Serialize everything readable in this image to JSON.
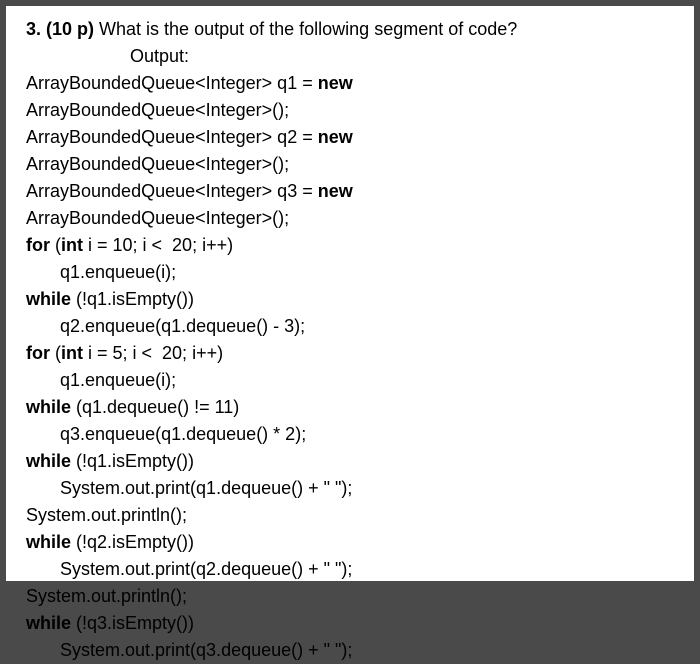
{
  "question": {
    "number_prefix": "3. (10 p) ",
    "prompt": "What is the output of the following segment of code?",
    "output_label": "Output:"
  },
  "code": {
    "l1a": "ArrayBoundedQueue<Integer> q1 = ",
    "l1b": "new",
    "l2": "ArrayBoundedQueue<Integer>();",
    "l3a": "ArrayBoundedQueue<Integer> q2 = ",
    "l3b": "new",
    "l4": "ArrayBoundedQueue<Integer>();",
    "l5a": "ArrayBoundedQueue<Integer> q3 = ",
    "l5b": "new",
    "l6": "ArrayBoundedQueue<Integer>();",
    "l7a": "for",
    "l7b": " (",
    "l7c": "int",
    "l7d": " i = 10; i <  20; i++)",
    "l8": "q1.enqueue(i);",
    "l9a": "while",
    "l9b": " (!q1.isEmpty())",
    "l10": "q2.enqueue(q1.dequeue() - 3);",
    "l11a": "for",
    "l11b": " (",
    "l11c": "int",
    "l11d": " i = 5; i <  20; i++)",
    "l12": "q1.enqueue(i);",
    "l13a": "while",
    "l13b": " (q1.dequeue() != 11)",
    "l14": "q3.enqueue(q1.dequeue() * 2);",
    "l15a": "while",
    "l15b": " (!q1.isEmpty())",
    "l16": "System.out.print(q1.dequeue() + \" \");",
    "l17": "System.out.println();",
    "l18a": "while",
    "l18b": " (!q2.isEmpty())",
    "l19": "System.out.print(q2.dequeue() + \" \");",
    "l20": "System.out.println();",
    "l21a": "while",
    "l21b": " (!q3.isEmpty())",
    "l22": "System.out.print(q3.dequeue() + \" \");"
  }
}
